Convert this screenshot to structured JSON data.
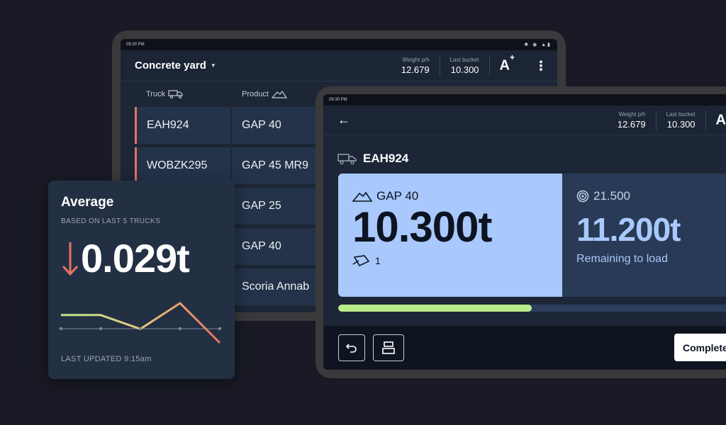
{
  "back_tablet": {
    "status_time": "09:30 PM",
    "status_icons": "✱ ◉ ▲▮",
    "yard_title": "Concrete yard",
    "weight_label": "Weight p/h",
    "weight_value": "12.679",
    "bucket_label": "Last bucket",
    "bucket_value": "10.300",
    "brand": "A",
    "brand_sup": "+",
    "menu_glyph": "⋮",
    "col_truck": "Truck",
    "col_product": "Product",
    "rows": [
      {
        "truck": "EAH924",
        "product": "GAP 40"
      },
      {
        "truck": "WOBZK295",
        "product": "GAP 45 MR9"
      },
      {
        "truck": "",
        "product": "GAP 25"
      },
      {
        "truck": "",
        "product": "GAP 40"
      },
      {
        "truck": "",
        "product": "Scoria Annab"
      }
    ]
  },
  "average": {
    "title": "Average",
    "subtitle": "BASED ON LAST 5 TRUCKS",
    "value": "0.029t",
    "trend": "down",
    "updated": "LAST UPDATED 9:15am",
    "sparkline": [
      0.7,
      0.7,
      0.35,
      1.0,
      0.0
    ]
  },
  "front_tablet": {
    "status_time": "09:30 PM",
    "back_glyph": "←",
    "weight_label": "Weight p/h",
    "weight_value": "12.679",
    "bucket_label": "Last bucket",
    "bucket_value": "10.300",
    "brand": "A",
    "brand_sup": "+",
    "truck_id": "EAH924",
    "product": "GAP 40",
    "loaded_weight": "10.300t",
    "bucket_count": "1",
    "target": "21.500",
    "remaining_weight": "11.200t",
    "remaining_label": "Remaining to load",
    "progress": 0.48,
    "complete_label": "Complete"
  },
  "colors": {
    "accent_red": "#e8735f",
    "light_blue": "#a9c8fb",
    "progress_green": "#b9ec8a"
  }
}
